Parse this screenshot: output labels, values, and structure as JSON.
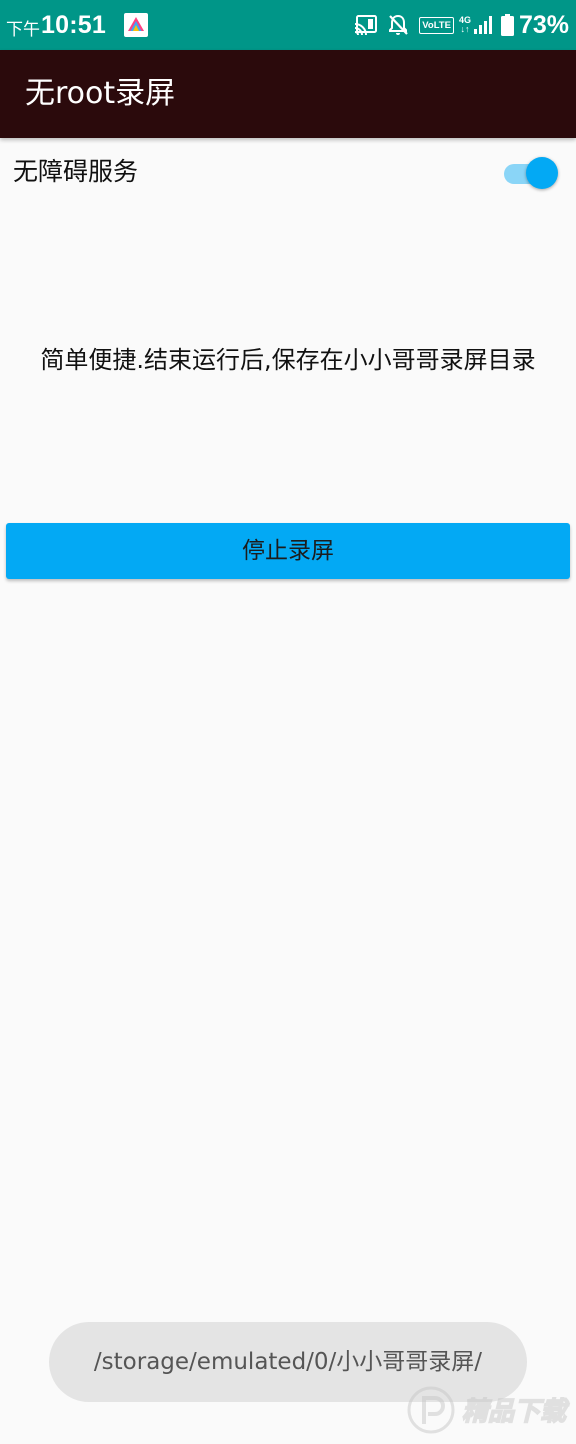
{
  "status_bar": {
    "period": "下午",
    "clock": "10:51",
    "network_label": "VoLTE",
    "network_type_top": "4G",
    "network_type_bottom": "↓↑",
    "battery_percent": "73%",
    "icons": [
      "app-notification-icon",
      "cast-icon",
      "notifications-off-icon",
      "signal-icon",
      "battery-icon"
    ],
    "background_color": "#009688"
  },
  "toolbar": {
    "title": "无root录屏",
    "background_color": "#2b0a0c"
  },
  "service": {
    "label": "无障碍服务",
    "switch_on": true,
    "accent_color": "#03a9f4"
  },
  "main": {
    "description": "简单便捷.结束运行后,保存在小小哥哥录屏目录",
    "stop_button_label": "停止录屏",
    "button_color": "#03a9f4"
  },
  "toast": {
    "message": "/storage/emulated/0/小小哥哥录屏/"
  },
  "watermark": {
    "text": "精品下载",
    "logo": "watermark-logo"
  }
}
